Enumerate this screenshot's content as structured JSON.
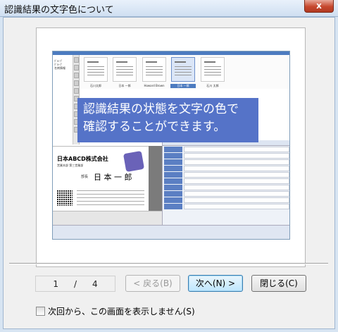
{
  "window": {
    "title": "認識結果の文字色について",
    "close_label": "x"
  },
  "preview": {
    "sidebar_items": [
      "ｸﾞﾙｰﾌﾟ",
      "ｸﾞﾙｰﾌﾟ",
      "名刺情報"
    ],
    "thumbnails": [
      {
        "label": "石川太郎",
        "selected": false
      },
      {
        "label": "日本 一郎",
        "selected": false
      },
      {
        "label": "Howard Brown",
        "selected": false
      },
      {
        "label": "日本 一郎",
        "selected": true
      },
      {
        "label": "石川 太郎",
        "selected": false
      }
    ],
    "banner_line1": "認識結果の状態を文字の色で",
    "banner_line2": "確認することができます。",
    "card": {
      "company": "日本ABCD株式会社",
      "dept": "営業本部 第三営業部",
      "name_label": "部長",
      "name": "日 本 一 郎"
    }
  },
  "navigation": {
    "current_page": "1",
    "separator": "/",
    "total_pages": "4",
    "back_label": "< 戻る(B)",
    "next_label": "次へ(N) >",
    "close_label": "閉じる(C)"
  },
  "option": {
    "checkbox_label": "次回から、この画面を表示しません(S)",
    "checked": false
  },
  "colors": {
    "banner": "#5573c8",
    "titlebar": "#cfdff1",
    "close_button": "#c6482e"
  }
}
